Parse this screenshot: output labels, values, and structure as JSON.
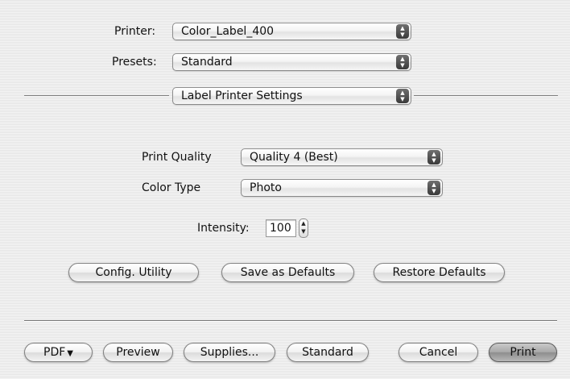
{
  "header": {
    "printer_label": "Printer:",
    "printer_value": "Color_Label_400",
    "presets_label": "Presets:",
    "presets_value": "Standard",
    "pane_value": "Label Printer Settings"
  },
  "settings": {
    "print_quality_label": "Print Quality",
    "print_quality_value": "Quality 4 (Best)",
    "color_type_label": "Color Type",
    "color_type_value": "Photo",
    "intensity_label": "Intensity:",
    "intensity_value": "100"
  },
  "actions": {
    "config_utility": "Config. Utility",
    "save_defaults": "Save as Defaults",
    "restore_defaults": "Restore Defaults"
  },
  "footer": {
    "pdf": "PDF",
    "preview": "Preview",
    "supplies": "Supplies...",
    "standard": "Standard",
    "cancel": "Cancel",
    "print": "Print"
  },
  "icons": {
    "popup_arrows": "up-down-arrows-icon",
    "pdf_caret": "triangle-down-icon",
    "stepper": "stepper-icon"
  },
  "colors": {
    "background": "#ececec",
    "default_button": "#a9a9a9"
  }
}
